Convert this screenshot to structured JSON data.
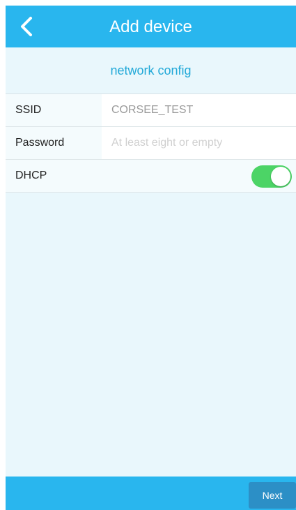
{
  "header": {
    "title": "Add device",
    "back_icon": "chevron-left-icon"
  },
  "section": {
    "title": "network config"
  },
  "form": {
    "ssid": {
      "label": "SSID",
      "value": "CORSEE_TEST",
      "placeholder": ""
    },
    "password": {
      "label": "Password",
      "value": "",
      "placeholder": "At least eight or empty"
    },
    "dhcp": {
      "label": "DHCP",
      "enabled": true
    }
  },
  "footer": {
    "next_label": "Next"
  },
  "colors": {
    "primary": "#29b6ee",
    "accent_text": "#22a9d8",
    "background": "#e9f7fc",
    "toggle_on": "#4cd466",
    "button": "#2c8fc6"
  }
}
